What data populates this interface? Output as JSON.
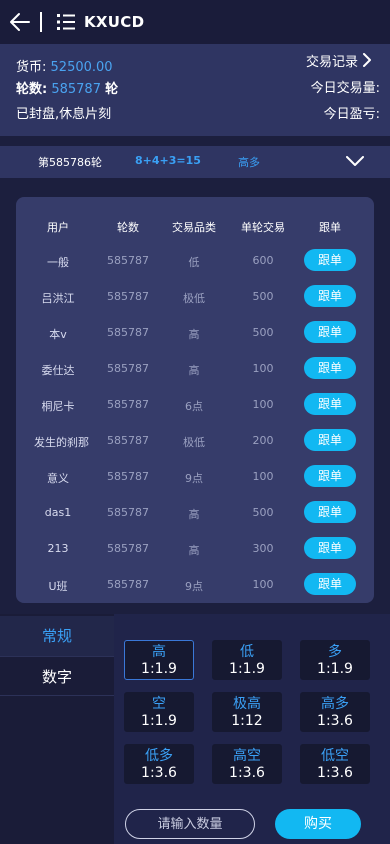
{
  "header": {
    "title": "KXUCD"
  },
  "account": {
    "currency_label": "货币:",
    "currency_value": "52500.00",
    "round_label": "轮数:",
    "round_value": "585787",
    "round_suffix": "轮",
    "status": "已封盘,休息片刻",
    "records_link": "交易记录",
    "today_volume_label": "今日交易量:",
    "today_pnl_label": "今日盈亏:"
  },
  "last_round": {
    "label": "第585786轮",
    "formula": "8+4+3=15",
    "result": "高多"
  },
  "table": {
    "headers": [
      "用户",
      "轮数",
      "交易品类",
      "单轮交易",
      "跟单"
    ],
    "follow_label": "跟单",
    "rows": [
      {
        "user": "一般",
        "round": "585787",
        "type": "低",
        "amount": "600"
      },
      {
        "user": "吕洪江",
        "round": "585787",
        "type": "极低",
        "amount": "500"
      },
      {
        "user": "本v",
        "round": "585787",
        "type": "高",
        "amount": "500"
      },
      {
        "user": "委仕达",
        "round": "585787",
        "type": "高",
        "amount": "100"
      },
      {
        "user": "桐尼卡",
        "round": "585787",
        "type": "6点",
        "amount": "100"
      },
      {
        "user": "发生的刹那",
        "round": "585787",
        "type": "极低",
        "amount": "200"
      },
      {
        "user": "意义",
        "round": "585787",
        "type": "9点",
        "amount": "100"
      },
      {
        "user": "das1",
        "round": "585787",
        "type": "高",
        "amount": "500"
      },
      {
        "user": "213",
        "round": "585787",
        "type": "高",
        "amount": "300"
      },
      {
        "user": "U班",
        "round": "585787",
        "type": "9点",
        "amount": "100"
      }
    ]
  },
  "tabs": {
    "regular": "常规",
    "digits": "数字"
  },
  "options": [
    {
      "label": "高",
      "odds": "1:1.9",
      "selected": true
    },
    {
      "label": "低",
      "odds": "1:1.9"
    },
    {
      "label": "多",
      "odds": "1:1.9"
    },
    {
      "label": "空",
      "odds": "1:1.9"
    },
    {
      "label": "极高",
      "odds": "1:12"
    },
    {
      "label": "高多",
      "odds": "1:3.6"
    },
    {
      "label": "低多",
      "odds": "1:3.6"
    },
    {
      "label": "高空",
      "odds": "1:3.6"
    },
    {
      "label": "低空",
      "odds": "1:3.6"
    }
  ],
  "order": {
    "quantity_placeholder": "请输入数量",
    "buy_label": "购买"
  },
  "colors": {
    "accent": "#3aa0f5",
    "button": "#12b8f2",
    "panel": "#2f3562",
    "background": "#1c1f3e"
  }
}
